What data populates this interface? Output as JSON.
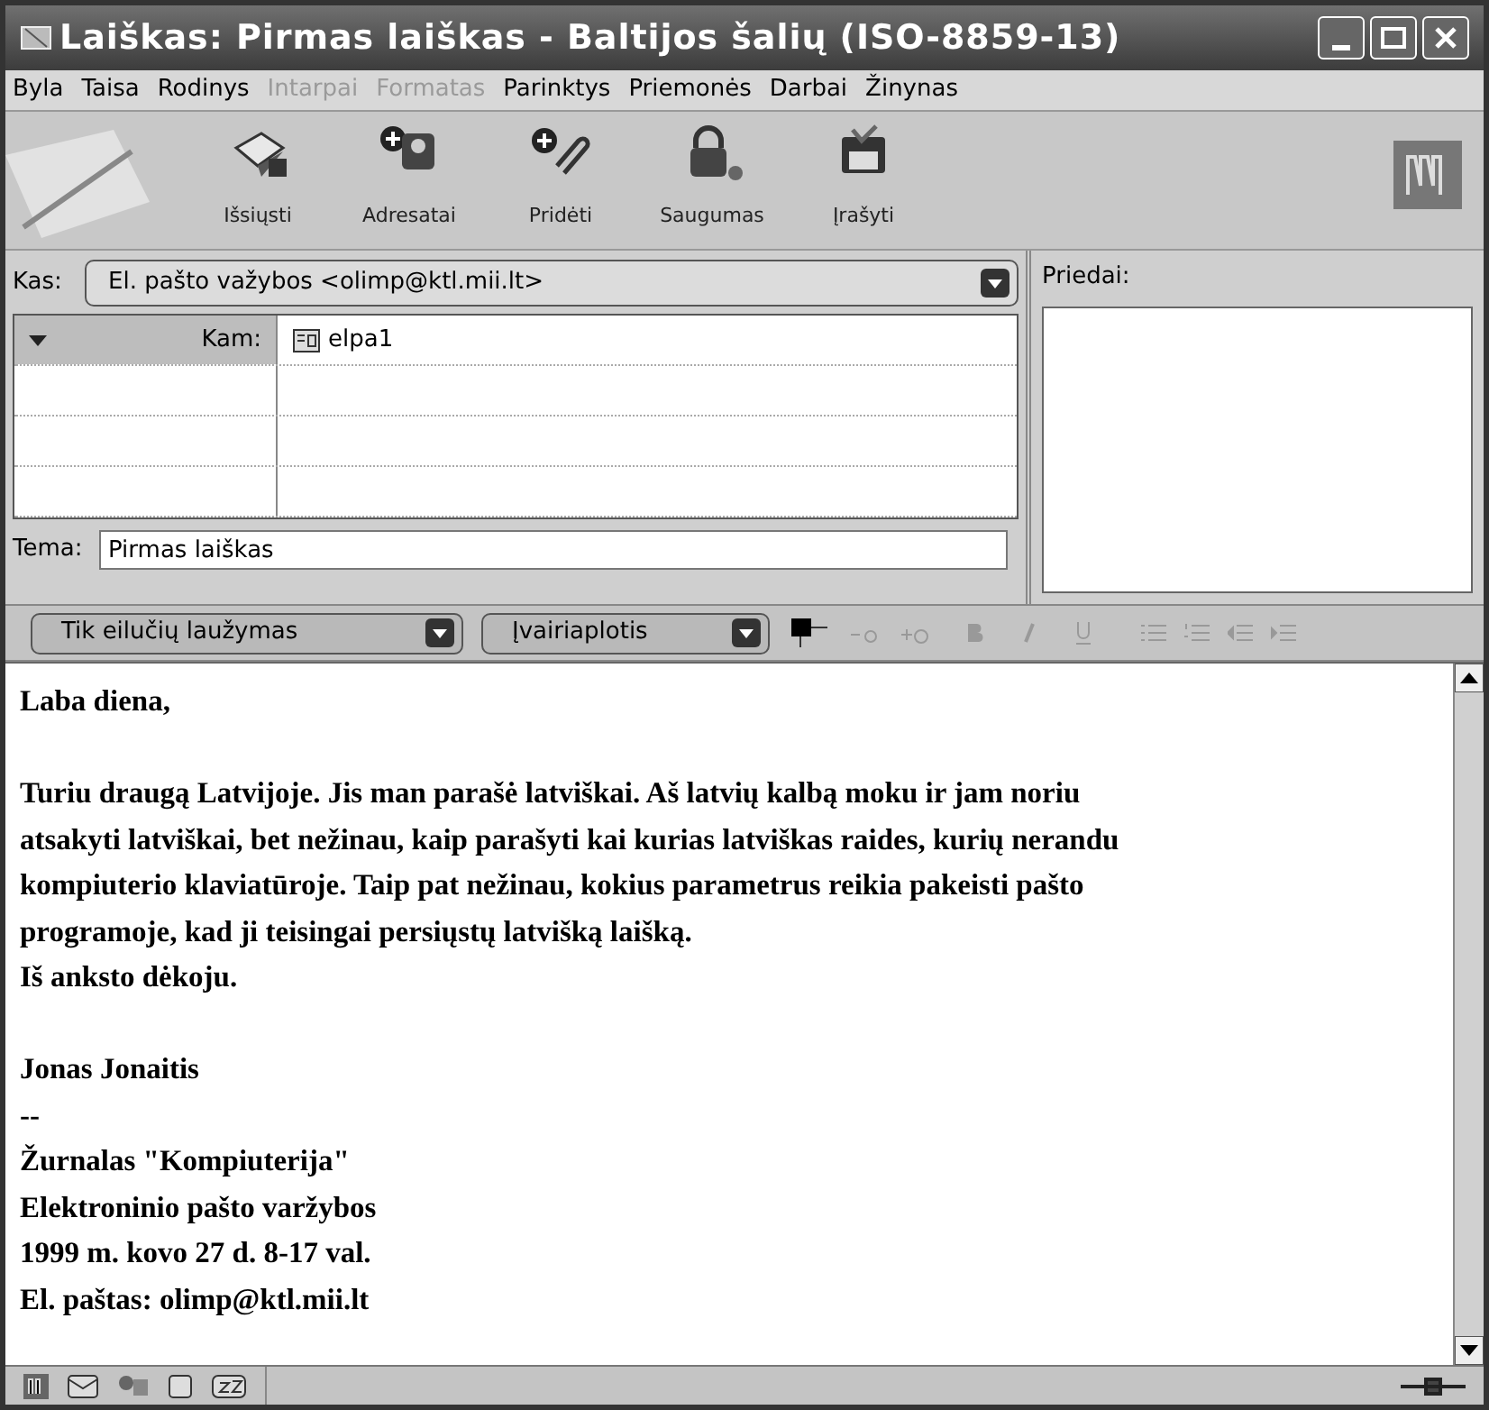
{
  "window": {
    "title": "Laiškas: Pirmas laiškas - Baltijos šalių (ISO-8859-13)"
  },
  "menu": [
    {
      "label": "Byla",
      "disabled": false
    },
    {
      "label": "Taisa",
      "disabled": false
    },
    {
      "label": "Rodinys",
      "disabled": false
    },
    {
      "label": "Intarpai",
      "disabled": true
    },
    {
      "label": "Formatas",
      "disabled": true
    },
    {
      "label": "Parinktys",
      "disabled": false
    },
    {
      "label": "Priemonės",
      "disabled": false
    },
    {
      "label": "Darbai",
      "disabled": false
    },
    {
      "label": "Žinynas",
      "disabled": false
    }
  ],
  "toolbar": [
    {
      "label": "Išsiųsti",
      "kind": "send"
    },
    {
      "label": "Adresatai",
      "kind": "contacts"
    },
    {
      "label": "Pridėti",
      "kind": "attach"
    },
    {
      "label": "Saugumas",
      "kind": "security"
    },
    {
      "label": "Įrašyti",
      "kind": "save"
    }
  ],
  "from": {
    "label": "Kas:",
    "value": "El. pašto važybos <olimp@ktl.mii.lt>"
  },
  "recipients": [
    {
      "type": "Kam:",
      "address": "elpa1"
    }
  ],
  "subject": {
    "label": "Tema:",
    "value": "Pirmas laiškas"
  },
  "attachments": {
    "label": "Priedai:"
  },
  "format_bar": {
    "paragraph": "Tik eilučių laužymas",
    "font": "Įvairiaplotis"
  },
  "body": [
    [
      "Laba diena,"
    ],
    [
      "Turiu draugą Latvijoje. Jis man parašė latviškai. Aš latvių kalbą moku ir jam noriu",
      "atsakyti latviškai, bet nežinau, kaip parašyti kai kurias latviškas raides, kurių nerandu",
      "kompiuterio klaviatūroje. Taip pat nežinau, kokius parametrus reikia pakeisti pašto",
      "programoje, kad ji teisingai persiųstų latvišką laišką.",
      "Iš anksto dėkoju."
    ],
    [
      "Jonas Jonaitis",
      "--",
      "Žurnalas \"Kompiuterija\"",
      "Elektroninio pašto varžybos",
      "1999 m. kovo 27 d. 8-17 val.",
      "El. paštas: olimp@ktl.mii.lt"
    ]
  ]
}
